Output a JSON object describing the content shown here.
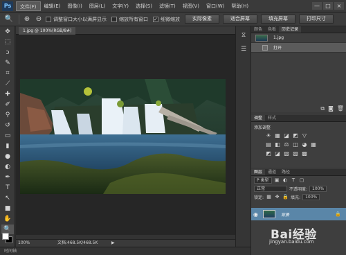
{
  "app": {
    "logo": "Ps"
  },
  "menu": [
    "文件(F)",
    "编辑(E)",
    "图像(I)",
    "图层(L)",
    "文字(Y)",
    "选择(S)",
    "滤镜(T)",
    "视图(V)",
    "窗口(W)",
    "帮助(H)"
  ],
  "window_controls": [
    "—",
    "□",
    "×"
  ],
  "options": {
    "checks": [
      {
        "label": "调整窗口大小以满屏显示",
        "checked": false
      },
      {
        "label": "缩放所有窗口",
        "checked": false
      },
      {
        "label": "细微缩放",
        "checked": true
      }
    ],
    "buttons": [
      "实际像素",
      "适合屏幕",
      "填充屏幕",
      "打印尺寸"
    ]
  },
  "document": {
    "tab_title": "1.jpg @ 100%(RGB/8#)",
    "zoom": "100%",
    "doc_info": "文档:468.5K/468.5K"
  },
  "history": {
    "tabs": [
      "颜色",
      "色板",
      "历史记录"
    ],
    "items": [
      {
        "label": "1.jpg"
      },
      {
        "label": "打开"
      }
    ]
  },
  "adjustments": {
    "tabs": [
      "调整",
      "样式"
    ],
    "title": "添加调整",
    "row1": [
      "☀",
      "▦",
      "◪",
      "◩",
      "▽"
    ],
    "row2": [
      "▤",
      "◧",
      "⚖",
      "◫",
      "◕",
      "▦"
    ],
    "row3": [
      "◩",
      "◪",
      "▨",
      "▧",
      "▩"
    ]
  },
  "layers": {
    "tabs": [
      "图层",
      "通道",
      "路径"
    ],
    "kind": "P 类型",
    "blend": "正常",
    "opacity_label": "不透明度:",
    "opacity": "100%",
    "lock_label": "锁定:",
    "fill_label": "填充:",
    "fill": "100%",
    "layer_name": "背景"
  },
  "watermark": {
    "brand": "Bai经验",
    "url": "jingyan.baidu.com"
  },
  "bottom": {
    "timeline": "时间轴"
  },
  "colors": {
    "accent": "#5a86a8",
    "fg": "#ffffff",
    "bg": "#000000"
  }
}
